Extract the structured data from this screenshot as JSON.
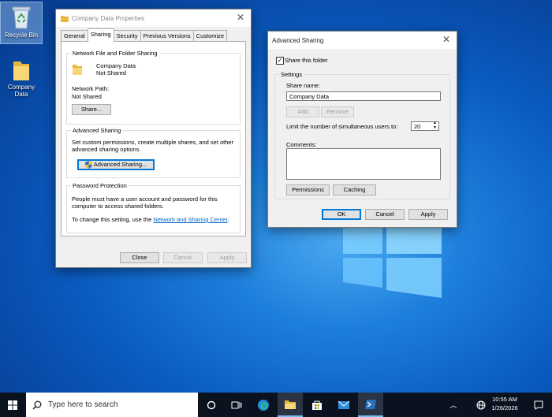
{
  "desktop": {
    "icons": [
      {
        "label": "Recycle Bin"
      },
      {
        "label": "Company Data"
      }
    ]
  },
  "properties_dialog": {
    "title": "Company Data Properties",
    "tabs": [
      "General",
      "Sharing",
      "Security",
      "Previous Versions",
      "Customize"
    ],
    "active_tab": "Sharing",
    "network_group": {
      "title": "Network File and Folder Sharing",
      "folder_name": "Company Data",
      "folder_status": "Not Shared",
      "network_path_label": "Network Path:",
      "network_path_value": "Not Shared",
      "share_button": "Share..."
    },
    "advanced_group": {
      "title": "Advanced Sharing",
      "description_line1": "Set custom permissions, create multiple shares, and set other",
      "description_line2": "advanced sharing options.",
      "button": "Advanced Sharing..."
    },
    "password_group": {
      "title": "Password Protection",
      "line1": "People must have a user account and password for this",
      "line2": "computer to access shared folders.",
      "line3_prefix": "To change this setting, use the ",
      "link": "Network and Sharing Center",
      "line3_suffix": "."
    },
    "buttons": {
      "close": "Close",
      "cancel": "Cancel",
      "apply": "Apply"
    }
  },
  "advanced_dialog": {
    "title": "Advanced Sharing",
    "share_checkbox_label": "Share this folder",
    "share_checked": true,
    "settings_title": "Settings",
    "share_name_label": "Share name:",
    "share_name_value": "Company Data",
    "add_button": "Add",
    "remove_button": "Remove",
    "limit_label": "Limit the number of simultaneous users to:",
    "limit_value": "20",
    "comments_label": "Comments:",
    "comments_value": "",
    "permissions_button": "Permissions",
    "caching_button": "Caching",
    "ok_button": "OK",
    "cancel_button": "Cancel",
    "apply_button": "Apply"
  },
  "taskbar": {
    "search_placeholder": "Type here to search",
    "time": "10:55 AM",
    "date": "1/26/2026"
  }
}
